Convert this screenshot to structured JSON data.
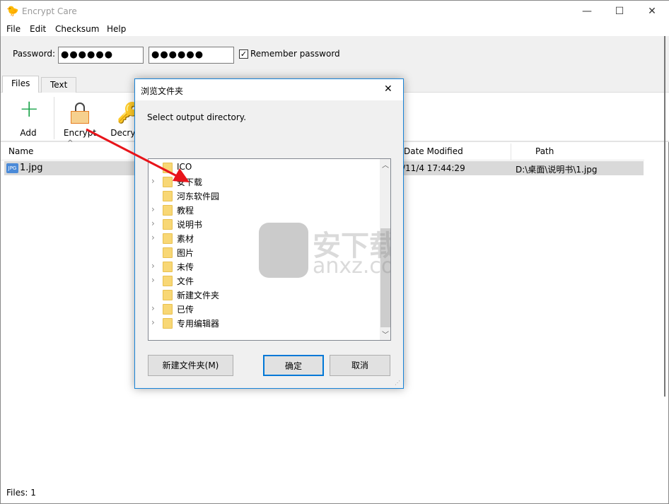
{
  "window": {
    "title": "Encrypt Care",
    "minimize": "—",
    "maximize": "☐",
    "close": "✕"
  },
  "menu": [
    "File",
    "Edit",
    "Checksum",
    "Help"
  ],
  "password": {
    "label": "Password:",
    "value1": "●●●●●●",
    "value2": "●●●●●●",
    "remember_label": "Remember password",
    "remember_checked": true
  },
  "tabs": [
    {
      "label": "Files",
      "active": true
    },
    {
      "label": "Text",
      "active": false
    }
  ],
  "toolbar": {
    "add": "Add",
    "encrypt": "Encrypt",
    "decrypt": "Decrypt"
  },
  "list": {
    "columns": [
      "Name",
      "Date Modified",
      "Path"
    ],
    "rows": [
      {
        "name": "1.jpg",
        "icon_text": "JPG",
        "date": "/11/4 17:44:29",
        "path": "D:\\桌面\\说明书\\1.jpg"
      }
    ]
  },
  "status": "Files: 1",
  "dialog": {
    "title": "浏览文件夹",
    "close": "✕",
    "prompt": "Select output directory.",
    "folders": [
      {
        "name": "ICO",
        "expandable": false
      },
      {
        "name": "安下载",
        "expandable": true
      },
      {
        "name": "河东软件园",
        "expandable": false
      },
      {
        "name": "教程",
        "expandable": true
      },
      {
        "name": "说明书",
        "expandable": true
      },
      {
        "name": "素材",
        "expandable": true
      },
      {
        "name": "图片",
        "expandable": false
      },
      {
        "name": "未传",
        "expandable": true
      },
      {
        "name": "文件",
        "expandable": true
      },
      {
        "name": "新建文件夹",
        "expandable": false
      },
      {
        "name": "已传",
        "expandable": true
      },
      {
        "name": "专用编辑器",
        "expandable": true
      }
    ],
    "new_folder": "新建文件夹(M)",
    "ok": "确定",
    "cancel": "取消"
  },
  "watermark": {
    "cn": "安下载",
    "en": "anxz.com"
  },
  "colors": {
    "accent": "#1883d7",
    "arrow": "#e8141a",
    "folder": "#f8d775"
  }
}
